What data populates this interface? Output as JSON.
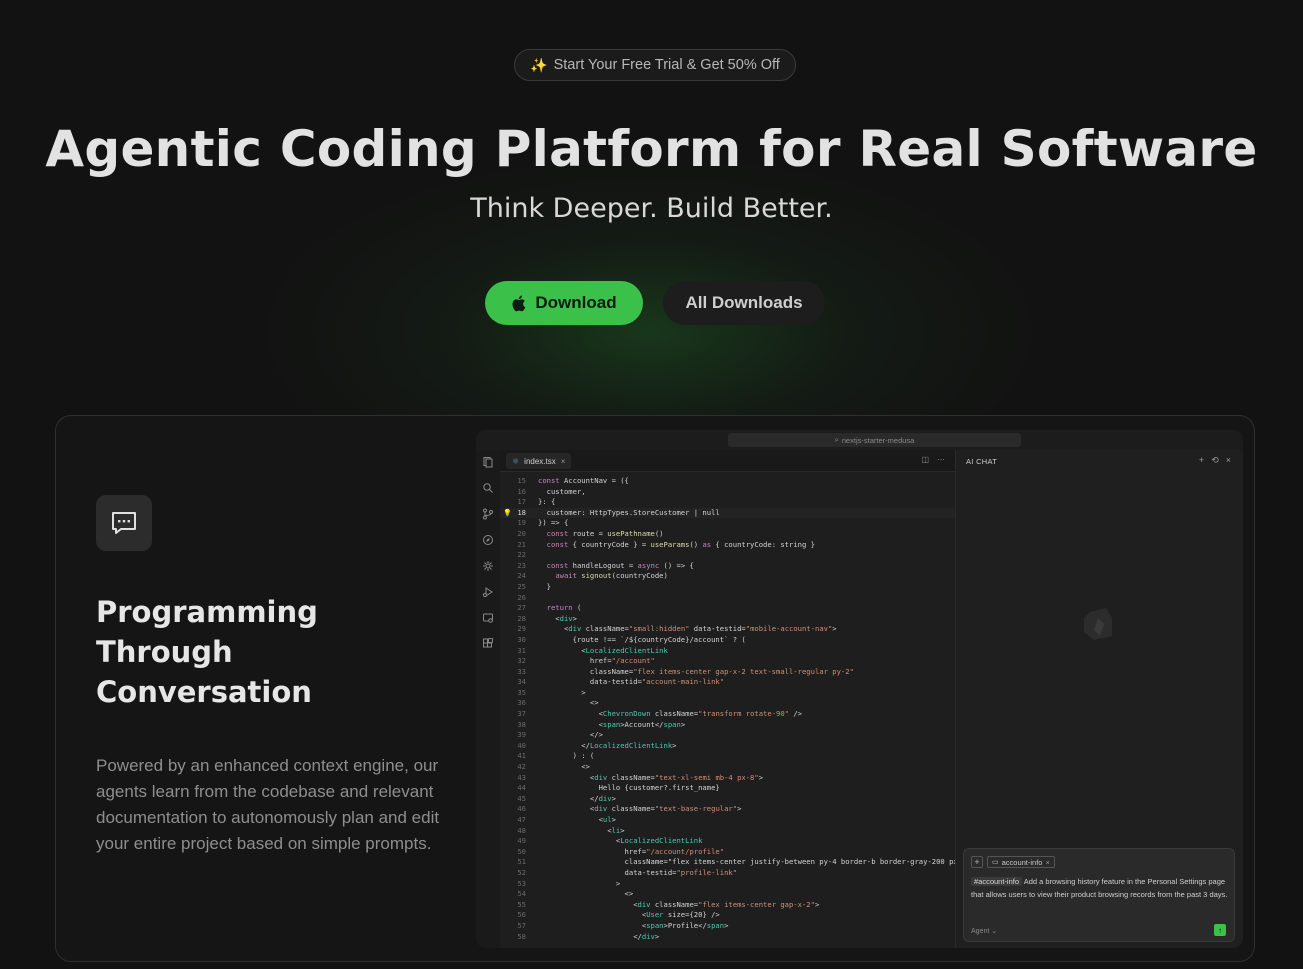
{
  "promo": {
    "icon": "sparkles-icon",
    "label": "Start Your Free Trial & Get 50% Off"
  },
  "hero": {
    "title": "Agentic Coding Platform for Real Software",
    "subtitle": "Think Deeper. Build Better."
  },
  "actions": {
    "download_label": "Download",
    "download_icon": "apple-icon",
    "all_downloads_label": "All Downloads"
  },
  "feature": {
    "icon": "chat-bubble-icon",
    "title": "Programming Through Conversation",
    "description": "Powered by an enhanced context engine, our agents learn from the codebase and relevant documentation to autonomously plan and edit your entire project based on simple prompts."
  },
  "ide": {
    "search_placeholder": "nextjs-starter-medusa",
    "tab_name": "index.tsx",
    "tab_close": "×",
    "tab_actions": [
      "◫",
      "⋯"
    ],
    "activity_icons": [
      "files-icon",
      "search-icon",
      "source-control-icon",
      "compass-icon",
      "settings-gear-icon",
      "run-debug-icon",
      "remote-icon",
      "extensions-icon"
    ],
    "chat_title": "AI CHAT",
    "chat_actions": [
      "+",
      "⟲",
      "×"
    ],
    "chat_input": {
      "plus": "+",
      "context_chip": "account-info",
      "context_close": "×",
      "tag": "#account-info",
      "prompt": "Add a browsing history feature in the Personal Settings page that allows users to view their product browsing records from the past 3 days.",
      "mode": "Agent",
      "send_icon": "↑"
    },
    "code_lines": [
      {
        "n": "15",
        "t": "const AccountNav = ({"
      },
      {
        "n": "16",
        "t": "  customer,"
      },
      {
        "n": "17",
        "t": "}: {"
      },
      {
        "n": "18",
        "t": "  customer: HttpTypes.StoreCustomer | null"
      },
      {
        "n": "19",
        "t": "}) => {"
      },
      {
        "n": "20",
        "t": "  const route = usePathname()"
      },
      {
        "n": "21",
        "t": "  const { countryCode } = useParams() as { countryCode: string }"
      },
      {
        "n": "22",
        "t": ""
      },
      {
        "n": "23",
        "t": "  const handleLogout = async () => {"
      },
      {
        "n": "24",
        "t": "    await signout(countryCode)"
      },
      {
        "n": "25",
        "t": "  }"
      },
      {
        "n": "26",
        "t": ""
      },
      {
        "n": "27",
        "t": "  return ("
      },
      {
        "n": "28",
        "t": "    <div>"
      },
      {
        "n": "29",
        "t": "      <div className=\"small:hidden\" data-testid=\"mobile-account-nav\">"
      },
      {
        "n": "30",
        "t": "        {route !== `/${countryCode}/account` ? ("
      },
      {
        "n": "31",
        "t": "          <LocalizedClientLink"
      },
      {
        "n": "32",
        "t": "            href=\"/account\""
      },
      {
        "n": "33",
        "t": "            className=\"flex items-center gap-x-2 text-small-regular py-2\""
      },
      {
        "n": "34",
        "t": "            data-testid=\"account-main-link\""
      },
      {
        "n": "35",
        "t": "          >"
      },
      {
        "n": "36",
        "t": "            <>"
      },
      {
        "n": "37",
        "t": "              <ChevronDown className=\"transform rotate-90\" />"
      },
      {
        "n": "38",
        "t": "              <span>Account</span>"
      },
      {
        "n": "39",
        "t": "            </>"
      },
      {
        "n": "40",
        "t": "          </LocalizedClientLink>"
      },
      {
        "n": "41",
        "t": "        ) : ("
      },
      {
        "n": "42",
        "t": "          <>"
      },
      {
        "n": "43",
        "t": "            <div className=\"text-xl-semi mb-4 px-8\">"
      },
      {
        "n": "44",
        "t": "              Hello {customer?.first_name}"
      },
      {
        "n": "45",
        "t": "            </div>"
      },
      {
        "n": "46",
        "t": "            <div className=\"text-base-regular\">"
      },
      {
        "n": "47",
        "t": "              <ul>"
      },
      {
        "n": "48",
        "t": "                <li>"
      },
      {
        "n": "49",
        "t": "                  <LocalizedClientLink"
      },
      {
        "n": "50",
        "t": "                    href=\"/account/profile\""
      },
      {
        "n": "51",
        "t": "                    className=\"flex items-center justify-between py-4 border-b border-gray-200 px-"
      },
      {
        "n": "52",
        "t": "                    data-testid=\"profile-link\""
      },
      {
        "n": "53",
        "t": "                  >"
      },
      {
        "n": "54",
        "t": "                    <>"
      },
      {
        "n": "55",
        "t": "                      <div className=\"flex items-center gap-x-2\">"
      },
      {
        "n": "56",
        "t": "                        <User size={20} />"
      },
      {
        "n": "57",
        "t": "                        <span>Profile</span>"
      },
      {
        "n": "58",
        "t": "                      </div>"
      }
    ],
    "active_line": "18"
  },
  "colors": {
    "accent": "#3bc14a",
    "background": "#121212",
    "card": "#151515"
  }
}
